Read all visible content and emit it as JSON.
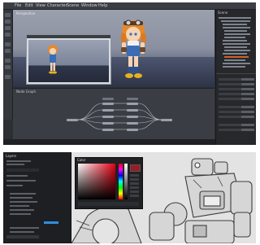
{
  "screenshot_top": {
    "menu": [
      "File",
      "Edit",
      "View",
      "Character",
      "Scene",
      "Window",
      "Help"
    ],
    "viewport_label": "Perspective",
    "inset_label": "Camera",
    "panel_title": "Scene",
    "nodegraph_tab": "Node Graph",
    "accent_color": "#d2622a"
  },
  "screenshot_bottom": {
    "panel_title": "Layers",
    "picker_title": "Color",
    "current_color": "#9b1b24",
    "highlight_color": "#2f8ee0"
  }
}
